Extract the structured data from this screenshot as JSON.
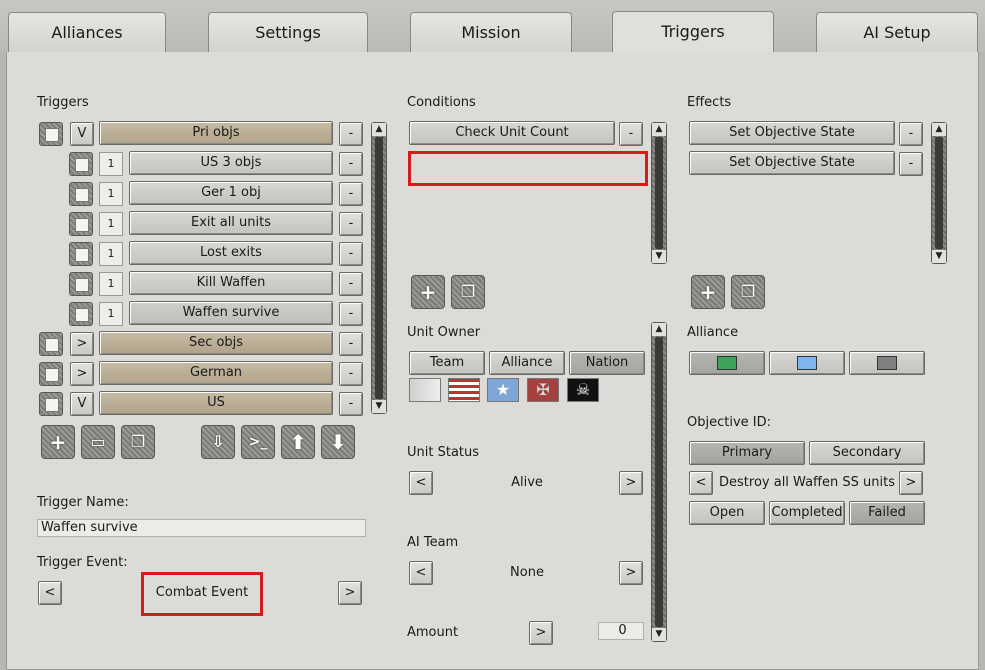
{
  "tabs": [
    {
      "label": "Alliances"
    },
    {
      "label": "Settings"
    },
    {
      "label": "Mission"
    },
    {
      "label": "Triggers"
    },
    {
      "label": "AI Setup"
    }
  ],
  "triggers": {
    "heading": "Triggers",
    "rows": [
      {
        "toggle": "V",
        "label": "Pri objs"
      },
      {
        "num": "1",
        "label": "US 3 objs"
      },
      {
        "num": "1",
        "label": "Ger 1 obj"
      },
      {
        "num": "1",
        "label": "Exit all units"
      },
      {
        "num": "1",
        "label": "Lost exits"
      },
      {
        "num": "1",
        "label": "Kill Waffen"
      },
      {
        "num": "1",
        "label": "Waffen survive"
      },
      {
        "toggle": ">",
        "label": "Sec objs"
      },
      {
        "toggle": ">",
        "label": "German"
      },
      {
        "toggle": "V",
        "label": "US"
      }
    ],
    "remove": "-",
    "name_label": "Trigger Name:",
    "name_value": "Waffen survive",
    "event_label": "Trigger Event:",
    "event_value": "Combat Event",
    "prev": "<",
    "next": ">"
  },
  "conditions": {
    "heading": "Conditions",
    "items": [
      {
        "label": "Check Unit Count"
      }
    ],
    "unit_owner_label": "Unit Owner",
    "owner_tabs": [
      "Team",
      "Alliance",
      "Nation"
    ],
    "owner_selected": "Nation",
    "unit_status_label": "Unit Status",
    "unit_status_value": "Alive",
    "ai_team_label": "AI Team",
    "ai_team_value": "None",
    "amount_label": "Amount",
    "amount_value": "0"
  },
  "effects": {
    "heading": "Effects",
    "items": [
      {
        "label": "Set Objective State"
      },
      {
        "label": "Set Objective State"
      }
    ],
    "alliance_label": "Alliance",
    "alliance_colors": [
      "#3fa35a",
      "#7fb6f2",
      "#808080"
    ],
    "objective_label": "Objective ID:",
    "obj_tabs": [
      "Primary",
      "Secondary"
    ],
    "obj_selected": "Primary",
    "objective_value": "Destroy all Waffen SS units",
    "state_tabs": [
      "Open",
      "Completed",
      "Failed"
    ],
    "state_selected": "Failed"
  },
  "colors": {
    "highlight": "#d71a1a",
    "tan": "#b8ab92"
  }
}
